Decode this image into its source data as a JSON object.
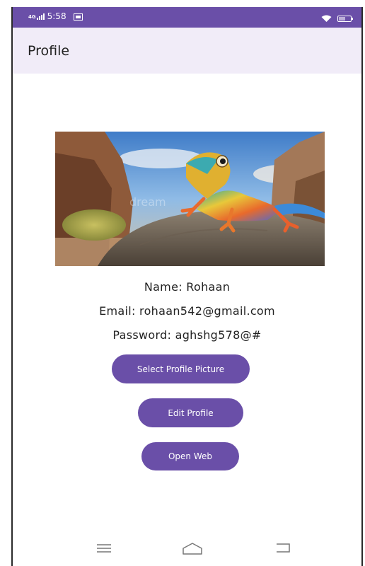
{
  "status_bar": {
    "network": "4G",
    "time": "5:58"
  },
  "app_bar": {
    "title": "Profile"
  },
  "profile": {
    "name": "Name: Rohaan",
    "email": "Email: rohaan542@gmail.com",
    "password": "Password: aghshg578@#"
  },
  "buttons": {
    "select_picture": "Select Profile Picture",
    "edit_profile": "Edit Profile",
    "open_web": "Open Web"
  },
  "photo": {
    "watermark": "dream"
  },
  "colors": {
    "primary": "#6a4fa8",
    "app_bar_bg": "#f1ecf8",
    "text": "#222222"
  },
  "icons": [
    "signal-icon",
    "sim-icon",
    "wifi-icon",
    "battery-icon",
    "menu-icon",
    "home-icon",
    "back-icon"
  ]
}
